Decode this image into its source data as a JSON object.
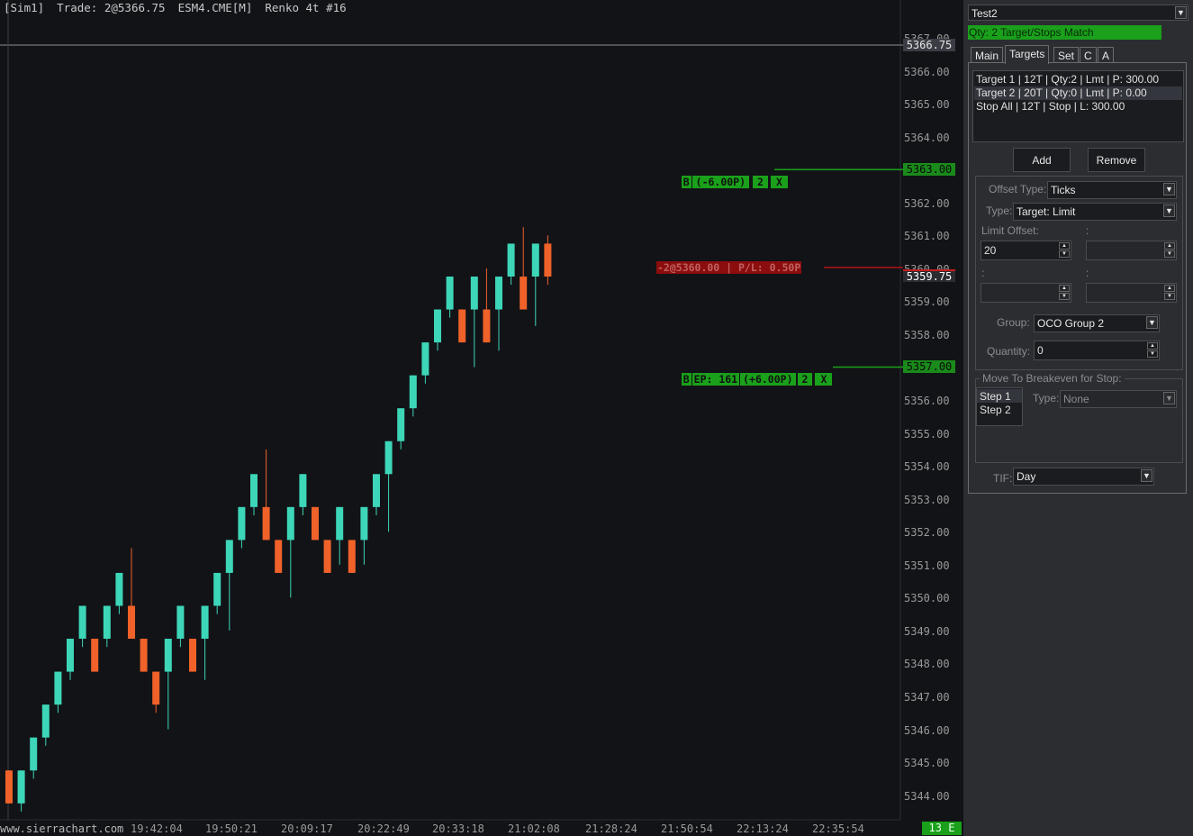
{
  "header": {
    "account": "[Sim1]",
    "trade": "Trade: 2@5366.75",
    "symbol": "ESM4.CME[M]",
    "chart_type": "Renko 4t #16"
  },
  "price_axis": {
    "labels": [
      "5367.00",
      "5366.00",
      "5365.00",
      "5364.00",
      "5363.00",
      "5362.00",
      "5361.00",
      "5360.00",
      "5359.00",
      "5358.00",
      "5357.00",
      "5356.00",
      "5355.00",
      "5354.00",
      "5353.00",
      "5352.00",
      "5351.00",
      "5350.00",
      "5349.00",
      "5348.00",
      "5347.00",
      "5346.00",
      "5345.00",
      "5344.00"
    ],
    "last_price": "5366.75",
    "current_price": "5359.75",
    "target_price": "5363.00",
    "stop_price": "5357.00"
  },
  "time_axis": {
    "watermark": "www.sierrachart.com",
    "labels": [
      "19:42:04",
      "19:50:21",
      "20:09:17",
      "20:22:49",
      "20:33:18",
      "21:02:08",
      "21:28:24",
      "21:50:54",
      "22:13:24",
      "22:35:54"
    ],
    "status_badge": "13 E"
  },
  "order_tags": {
    "target": [
      "B",
      "(-6.00P)",
      "2",
      "X"
    ],
    "position": "-2@5360.00 | P/L: 0.50P",
    "stop": [
      "B",
      "EP: 161",
      "(+6.00P)",
      "2",
      "X"
    ]
  },
  "chart_data": {
    "type": "candlestick",
    "title": "ESM4.CME[M] Renko 4t #16",
    "candles": [
      {
        "o": 5343.75,
        "c": 5344.75,
        "h": 5344.75,
        "l": 5343.75,
        "dir": "down"
      },
      {
        "o": 5343.75,
        "c": 5344.75,
        "h": 5344.75,
        "l": 5343.5,
        "dir": "up"
      },
      {
        "o": 5344.75,
        "c": 5345.75,
        "h": 5345.75,
        "l": 5344.5,
        "dir": "up"
      },
      {
        "o": 5345.75,
        "c": 5346.75,
        "h": 5346.75,
        "l": 5345.5,
        "dir": "up"
      },
      {
        "o": 5346.75,
        "c": 5347.75,
        "h": 5347.75,
        "l": 5346.5,
        "dir": "up"
      },
      {
        "o": 5347.75,
        "c": 5348.75,
        "h": 5348.75,
        "l": 5347.5,
        "dir": "up"
      },
      {
        "o": 5348.75,
        "c": 5349.75,
        "h": 5349.75,
        "l": 5348.5,
        "dir": "up"
      },
      {
        "o": 5348.75,
        "c": 5347.75,
        "h": 5348.75,
        "l": 5347.75,
        "dir": "down"
      },
      {
        "o": 5348.75,
        "c": 5349.75,
        "h": 5349.75,
        "l": 5348.5,
        "dir": "up"
      },
      {
        "o": 5349.75,
        "c": 5350.75,
        "h": 5350.75,
        "l": 5349.5,
        "dir": "up"
      },
      {
        "o": 5349.75,
        "c": 5348.75,
        "h": 5351.5,
        "l": 5348.75,
        "dir": "down"
      },
      {
        "o": 5348.75,
        "c": 5347.75,
        "h": 5348.75,
        "l": 5347.75,
        "dir": "down"
      },
      {
        "o": 5347.75,
        "c": 5346.75,
        "h": 5347.75,
        "l": 5346.5,
        "dir": "down"
      },
      {
        "o": 5347.75,
        "c": 5348.75,
        "h": 5348.75,
        "l": 5346.0,
        "dir": "up"
      },
      {
        "o": 5348.75,
        "c": 5349.75,
        "h": 5349.75,
        "l": 5348.5,
        "dir": "up"
      },
      {
        "o": 5348.75,
        "c": 5347.75,
        "h": 5348.75,
        "l": 5347.75,
        "dir": "down"
      },
      {
        "o": 5348.75,
        "c": 5349.75,
        "h": 5349.75,
        "l": 5347.5,
        "dir": "up"
      },
      {
        "o": 5349.75,
        "c": 5350.75,
        "h": 5350.75,
        "l": 5349.5,
        "dir": "up"
      },
      {
        "o": 5350.75,
        "c": 5351.75,
        "h": 5351.75,
        "l": 5349.0,
        "dir": "up"
      },
      {
        "o": 5351.75,
        "c": 5352.75,
        "h": 5352.75,
        "l": 5351.5,
        "dir": "up"
      },
      {
        "o": 5352.75,
        "c": 5353.75,
        "h": 5353.75,
        "l": 5352.5,
        "dir": "up"
      },
      {
        "o": 5352.75,
        "c": 5351.75,
        "h": 5354.5,
        "l": 5351.75,
        "dir": "down"
      },
      {
        "o": 5351.75,
        "c": 5350.75,
        "h": 5351.75,
        "l": 5350.75,
        "dir": "down"
      },
      {
        "o": 5351.75,
        "c": 5352.75,
        "h": 5352.75,
        "l": 5350.0,
        "dir": "up"
      },
      {
        "o": 5352.75,
        "c": 5353.75,
        "h": 5353.75,
        "l": 5352.5,
        "dir": "up"
      },
      {
        "o": 5352.75,
        "c": 5351.75,
        "h": 5352.75,
        "l": 5351.75,
        "dir": "down"
      },
      {
        "o": 5351.75,
        "c": 5350.75,
        "h": 5351.75,
        "l": 5350.75,
        "dir": "down"
      },
      {
        "o": 5351.75,
        "c": 5352.75,
        "h": 5352.75,
        "l": 5351.0,
        "dir": "up"
      },
      {
        "o": 5351.75,
        "c": 5350.75,
        "h": 5351.75,
        "l": 5350.75,
        "dir": "down"
      },
      {
        "o": 5351.75,
        "c": 5352.75,
        "h": 5352.75,
        "l": 5351.0,
        "dir": "up"
      },
      {
        "o": 5352.75,
        "c": 5353.75,
        "h": 5353.75,
        "l": 5352.5,
        "dir": "up"
      },
      {
        "o": 5353.75,
        "c": 5354.75,
        "h": 5354.75,
        "l": 5352.0,
        "dir": "up"
      },
      {
        "o": 5354.75,
        "c": 5355.75,
        "h": 5355.75,
        "l": 5354.5,
        "dir": "up"
      },
      {
        "o": 5355.75,
        "c": 5356.75,
        "h": 5356.75,
        "l": 5355.5,
        "dir": "up"
      },
      {
        "o": 5356.75,
        "c": 5357.75,
        "h": 5357.75,
        "l": 5356.5,
        "dir": "up"
      },
      {
        "o": 5357.75,
        "c": 5358.75,
        "h": 5358.75,
        "l": 5357.5,
        "dir": "up"
      },
      {
        "o": 5358.75,
        "c": 5359.75,
        "h": 5359.75,
        "l": 5358.5,
        "dir": "up"
      },
      {
        "o": 5358.75,
        "c": 5357.75,
        "h": 5358.75,
        "l": 5357.75,
        "dir": "down"
      },
      {
        "o": 5358.75,
        "c": 5359.75,
        "h": 5359.75,
        "l": 5357.0,
        "dir": "up"
      },
      {
        "o": 5358.75,
        "c": 5357.75,
        "h": 5360.0,
        "l": 5357.75,
        "dir": "down"
      },
      {
        "o": 5358.75,
        "c": 5359.75,
        "h": 5359.75,
        "l": 5357.5,
        "dir": "up"
      },
      {
        "o": 5359.75,
        "c": 5360.75,
        "h": 5360.75,
        "l": 5359.5,
        "dir": "up"
      },
      {
        "o": 5359.75,
        "c": 5358.75,
        "h": 5361.25,
        "l": 5358.75,
        "dir": "down"
      },
      {
        "o": 5359.75,
        "c": 5360.75,
        "h": 5360.75,
        "l": 5358.25,
        "dir": "up"
      },
      {
        "o": 5360.75,
        "c": 5359.75,
        "h": 5361.0,
        "l": 5359.5,
        "dir": "down"
      }
    ],
    "ylim": [
      5343.5,
      5367.5
    ],
    "up_color": "#3dd6b8",
    "down_color": "#f0622a"
  },
  "panel": {
    "profile": "Test2",
    "qty_status": "Qty: 2 Target/Stops Match",
    "tabs": [
      "Main",
      "Targets",
      "Set",
      "C",
      "A"
    ],
    "active_tab": "Targets",
    "target_list": [
      "Target 1 | 12T | Qty:2 | Lmt | P: 300.00",
      "Target 2 | 20T | Qty:0 | Lmt | P: 0.00",
      "Stop All | 12T | Stop | L: 300.00"
    ],
    "add_label": "Add",
    "remove_label": "Remove",
    "offset_type_label": "Offset Type:",
    "offset_type_value": "Ticks",
    "type_label": "Type:",
    "type_value": "Target: Limit",
    "limit_offset_label": "Limit Offset:",
    "limit_offset_value": "20",
    "colon": ":",
    "group_label": "Group:",
    "group_value": "OCO Group 2",
    "quantity_label": "Quantity:",
    "quantity_value": "0",
    "breakeven_label": "Move To Breakeven for Stop:",
    "steps": [
      "Step 1",
      "Step 2"
    ],
    "be_type_label": "Type:",
    "be_type_value": "None",
    "tif_label": "TIF:",
    "tif_value": "Day"
  }
}
